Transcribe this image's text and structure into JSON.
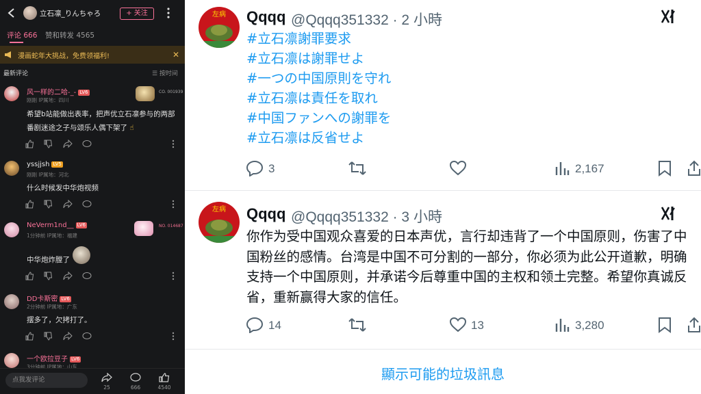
{
  "left": {
    "header": {
      "username": "立石凛_りんちゃろ",
      "follow_label": "+ 关注"
    },
    "tabs": [
      {
        "label": "评论 666"
      },
      {
        "label": "赞和转发 4565"
      }
    ],
    "notice": {
      "text": "漫画蛇年大挑战，免费领福利!",
      "close": "✕"
    },
    "sort": {
      "left": "最新评论",
      "right": "☰ 按时间"
    },
    "comments": [
      {
        "name": "风一样的二哈-_-",
        "level": "LV6",
        "meta": "刚刚  IP属地：四川",
        "text": "希望b站能做出表率，把声优立石凛参与的两部番剧迷途之子与颂乐人偶下架了",
        "badge": "CO. 001939"
      },
      {
        "name": "yssjjsh",
        "level": "LV5",
        "meta": "刚刚  IP属地：河北",
        "text": "什么时候发中华炮视频"
      },
      {
        "name": "NeVerm1nd__",
        "level": "LV6",
        "meta": "1分钟前  IP属地：福建",
        "text": "中华炮炸膛了",
        "badge": "NO. 014687"
      },
      {
        "name": "DD卡斯密",
        "level": "LV6",
        "meta": "2分钟前  IP属地：广东",
        "text": "摆多了，欠拷打了。"
      },
      {
        "name": "一个欧拉豆子",
        "level": "LV6",
        "meta": "3分钟前  IP属地：山东"
      }
    ],
    "bottom": {
      "placeholder": "点我发评论",
      "share_count": "25",
      "comment_count": "666",
      "like_count": "4540"
    }
  },
  "tweets": [
    {
      "name": "Qqqq",
      "handle": "@Qqqq351332 · 2 小時",
      "lines": [
        "#立石凛謝罪要求",
        "#立石凛は謝罪せよ",
        "#一つの中国原則を守れ",
        "#立石凛は責任を取れ",
        "#中国ファンへの謝罪を",
        "#立石凛は反省せよ"
      ],
      "replies": "3",
      "retweets": "",
      "likes": "",
      "views": "2,167"
    },
    {
      "name": "Qqqq",
      "handle": "@Qqqq351332 · 3 小時",
      "body": "你作为受中国观众喜爱的日本声优，言行却违背了一个中国原则，伤害了中国粉丝的感情。台湾是中国不可分割的一部分，你必须为此公开道歉，明确支持一个中国原则，并承诺今后尊重中国的主权和领土完整。希望你真诚反省，重新赢得大家的信任。",
      "replies": "14",
      "retweets": "",
      "likes": "13",
      "views": "3,280"
    }
  ],
  "spam_label": "顯示可能的垃圾訊息",
  "avatar_text": "左病",
  "colors": {
    "bili_pink": "#fb7299",
    "notice_gold": "#e9b955",
    "twitter_blue": "#1d9bf0",
    "lv6": "#e5595a",
    "lv5": "#f0a020"
  }
}
